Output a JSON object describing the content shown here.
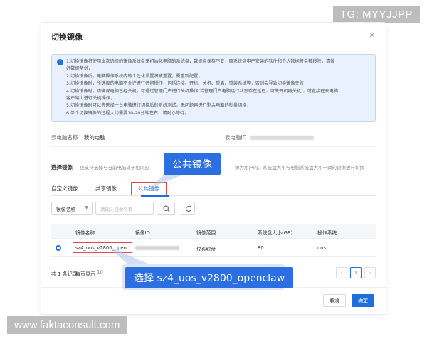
{
  "watermark_top": "TG: MYYJJPP",
  "watermark_bottom": "www.faktaconsult.com",
  "dialog": {
    "title": "切换镜像",
    "close": "×",
    "notice_lines": [
      "1.切换镜像将使用本次选择的镜像系统盘来初始化电脑的系统盘，数据盘保持不变，原系统盘中已安装的软件和个人数据将会被移除，请做",
      "好数据备份；",
      "2.切换镜像后，电脑操作系统内的个性化设置将被重置，需重新配置；",
      "3.切换镜像时，所选择的电脑不允许进行任何操作，包括连接、开机、关机、重启、重装系统等，否则会导致切换镜像失败；",
      "4.切换镜像时，请确保电脑已经关机，可通过管理门户进行关机操作(若管理门户电脑运行状态存在延迟，可先开机再关机)，或直接在云电脑",
      "客户端上进行关机操作；",
      "5.切换镜像时可以先选择一台电脑进行切换后的系统测试，无问题再进行剩余电脑的批量切换；",
      "6.单个切换镜像的过程大约需要10-20分钟左右，请耐心等待。"
    ],
    "pc_name_label": "云电脑名称",
    "pc_name_value": "我的电脑",
    "pc_id_label": "云电脑ID",
    "select_label": "选择镜像",
    "select_desc": "仅支持选择与当前电脑处于相同应",
    "select_desc2": "源为用户的、系统盘大小与电脑系统盘大小一致的镜像进行切换",
    "tabs": [
      "自定义镜像",
      "共享镜像",
      "公共镜像"
    ],
    "filter_select": "镜像名称",
    "filter_placeholder": "请输入镜像名称",
    "columns": [
      "镜像名称",
      "镜像ID",
      "镜像范围",
      "系统盘大小(GB)",
      "操作系统"
    ],
    "rows": [
      {
        "name": "sz4_uos_v2800_open...",
        "scope": "仅系统盘",
        "disk": "80",
        "os": "uos"
      }
    ],
    "total": "共 1 条记录",
    "per_page": "每页显示",
    "per_page_value": "10",
    "page_prev": "‹",
    "page_current": "1",
    "page_next": "›",
    "cancel": "取消",
    "ok": "确定"
  },
  "callouts": {
    "public": "公共镜像",
    "select": "选择 sz4_uos_v2800_openclaw"
  },
  "colors": {
    "accent": "#1e6fd9",
    "callout": "#2b6fe0",
    "highlight_border": "#e34b4b",
    "notice_bg": "#e8f1fd"
  }
}
